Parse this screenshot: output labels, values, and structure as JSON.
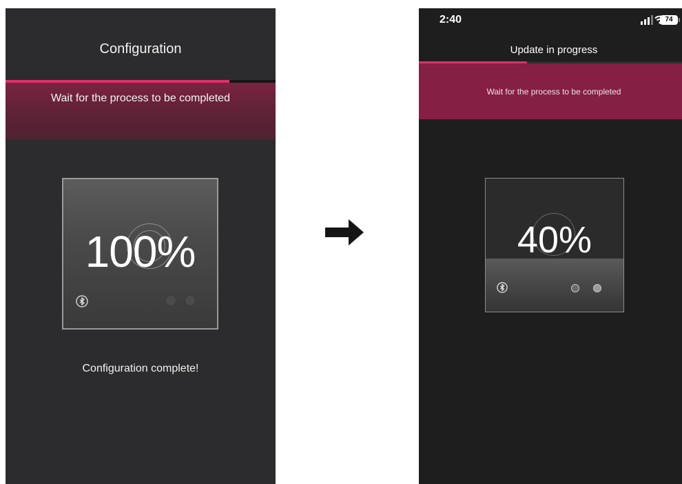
{
  "left_screen": {
    "title": "Configuration",
    "banner_text": "Wait for the process to be completed",
    "progress": 0.83,
    "percent_label": "100%",
    "status_text": "Configuration complete!",
    "colors": {
      "accent": "#e0306a",
      "banner": "#5e2235",
      "background": "#2c2c2e"
    },
    "icons": [
      "bluetooth-icon",
      "indicator-dot",
      "indicator-dot"
    ]
  },
  "right_screen": {
    "status_bar": {
      "time": "2:40",
      "battery": "74"
    },
    "title": "Update in progress",
    "banner_text": "Wait for the process to be completed",
    "progress": 0.4,
    "percent_label": "40%",
    "colors": {
      "accent": "#d8336a",
      "banner": "#851f44",
      "background": "#1e1e1e"
    },
    "icons": [
      "signal-icon",
      "wifi-icon",
      "battery-icon",
      "bluetooth-icon",
      "indicator-dot",
      "indicator-dot"
    ]
  },
  "transition": {
    "icon": "arrow-right-icon"
  }
}
